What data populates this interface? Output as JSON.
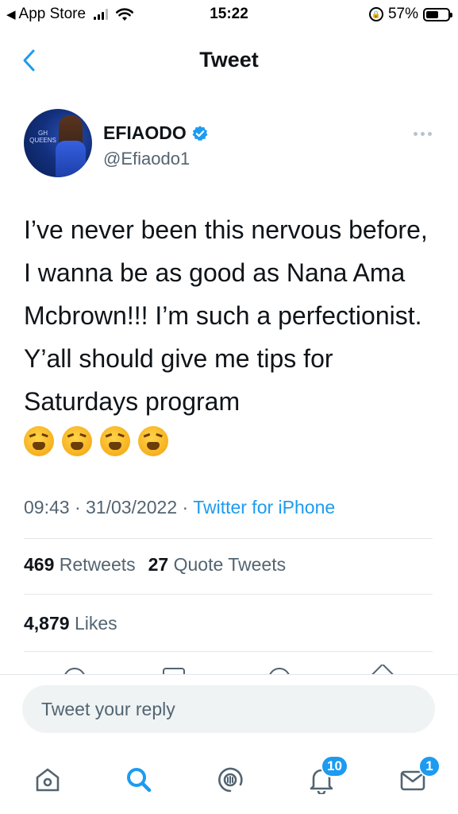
{
  "status_bar": {
    "back_app": "App Store",
    "time": "15:22",
    "battery": "57%",
    "battery_level": 0.57
  },
  "header": {
    "title": "Tweet"
  },
  "tweet": {
    "author": {
      "display_name": "EFIAODO",
      "handle": "@Efiaodo1",
      "avatar_text": "GH QUEENS"
    },
    "text": "I’ve never been this nervous before, I wanna be as good as Nana Ama Mcbrown!!! I’m such a perfectionist. Y’all should give me tips for Saturdays program",
    "emoji": [
      "tired-face",
      "tired-face",
      "tired-face",
      "tired-face"
    ],
    "time": "09:43",
    "date": "31/03/2022",
    "source": "Twitter for iPhone",
    "separator": "·",
    "retweets_count": "469",
    "retweets_label": "Retweets",
    "quotes_count": "27",
    "quotes_label": "Quote Tweets",
    "likes_count": "4,879",
    "likes_label": "Likes"
  },
  "reply": {
    "placeholder": "Tweet your reply"
  },
  "tab_bar": {
    "items": [
      {
        "name": "home",
        "icon": "home-icon"
      },
      {
        "name": "search",
        "icon": "search-icon"
      },
      {
        "name": "spaces",
        "icon": "spaces-icon"
      },
      {
        "name": "notifications",
        "icon": "bell-icon",
        "badge": "10"
      },
      {
        "name": "messages",
        "icon": "envelope-icon",
        "badge": "1"
      }
    ]
  },
  "colors": {
    "accent": "#1d9bf0",
    "text_primary": "#0f1419",
    "text_secondary": "#536471"
  }
}
